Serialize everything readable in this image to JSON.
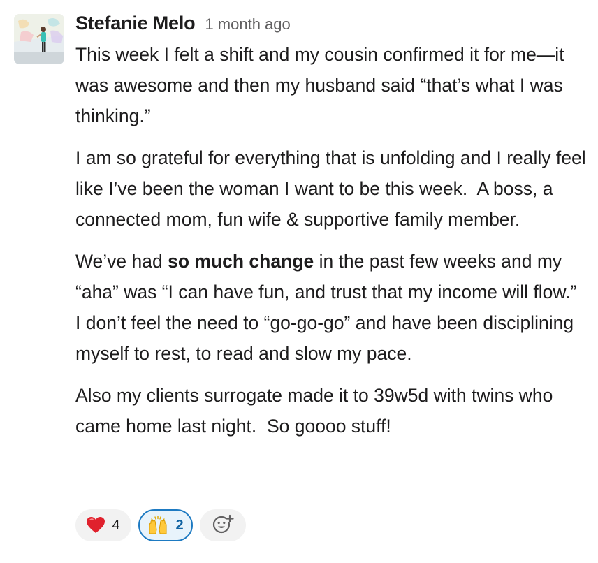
{
  "message": {
    "author": "Stefanie Melo",
    "timestamp": "1 month ago",
    "paragraphs": {
      "p1": "This week I felt a shift and my cousin confirmed it for me—it was awesome and then my husband said “that’s what I was thinking.”",
      "p2": "I am so grateful for everything that is unfolding and I really feel like I’ve been the woman I want to be this week.  A boss, a connected mom, fun wife & supportive family member.",
      "p3_before": "We’ve had ",
      "p3_bold": "so much change",
      "p3_after": " in the past few weeks and my “aha” was “I can have fun, and trust that my income will flow.”  I don’t feel the need to “go-go-go” and have been disciplining myself to rest, to read and slow my pace.",
      "p4": "Also my clients surrogate made it to 39w5d with twins who came home last night.  So goooo stuff!"
    }
  },
  "reactions": [
    {
      "emoji": "heart-emoji",
      "count": "4",
      "selected": false
    },
    {
      "emoji": "raising-hands-emoji",
      "count": "2",
      "selected": true
    }
  ],
  "add_reaction_icon": "add-emoji-icon",
  "colors": {
    "text": "#1d1c1d",
    "muted": "#616061",
    "reaction_bg": "#f2f2f2",
    "selected_border": "#1d7ac2",
    "selected_bg": "#e8f3fb",
    "selected_count": "#1264a3",
    "heart": "#e0212d"
  }
}
